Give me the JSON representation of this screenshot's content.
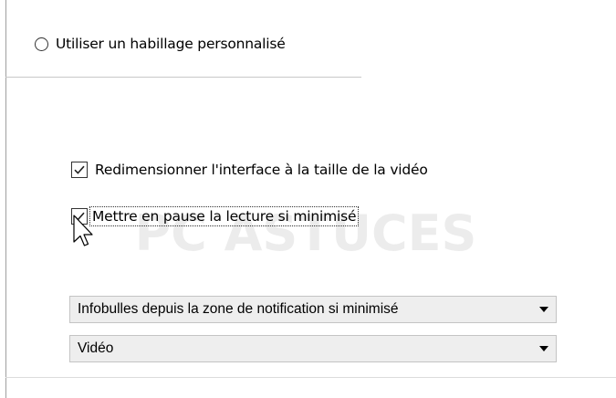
{
  "skin_option": {
    "custom_skin_label": "Utiliser un habillage personnalisé",
    "selected": false
  },
  "options": {
    "resize_interface": {
      "label": "Redimensionner l'interface à la taille de la vidéo",
      "checked": true
    },
    "pause_when_minimized": {
      "label": "Mettre en pause la lecture si minimisé",
      "checked": true,
      "focused": true
    }
  },
  "dropdowns": {
    "notification_tooltips": {
      "value": "Infobulles depuis la zone de notification si minimisé"
    },
    "systray_mode": {
      "value": "Vidéo"
    }
  },
  "watermark": {
    "text": "PC ASTUCES"
  },
  "colors": {
    "background": "#ffffff",
    "dropdown_background": "#eeeeee",
    "border": "#333333",
    "panel_border": "#a0a0a0"
  },
  "icons": {
    "radio": "radio-unchecked-icon",
    "checkbox": "checkbox-checked-icon",
    "dropdown": "triangle-down-icon",
    "cursor": "mouse-pointer-icon"
  }
}
